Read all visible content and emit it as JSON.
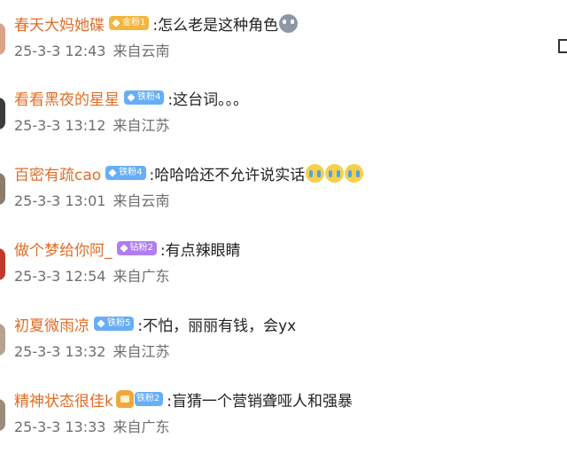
{
  "comments": [
    {
      "username": "春天大妈她碟",
      "badge": "金粉1",
      "badge_color": "#f4b63f",
      "text": ":怎么老是这种角色",
      "emoji": [
        "gray"
      ],
      "date": "25-3-3 12:43",
      "location": "来自云南"
    },
    {
      "username": "看看黑夜的星星",
      "badge": "铁粉4",
      "badge_color": "#66aef6",
      "text": ":这台词。。。",
      "emoji": [],
      "date": "25-3-3 13:12",
      "location": "来自江苏"
    },
    {
      "username": "百密有疏cao",
      "badge": "铁粉4",
      "badge_color": "#66aef6",
      "text": ":哈哈哈还不允许说实话",
      "emoji": [
        "cry",
        "cry",
        "cry"
      ],
      "date": "25-3-3 13:01",
      "location": "来自云南"
    },
    {
      "username": "做个梦给你阿_",
      "badge": "钻粉2",
      "badge_color": "#b07ef1",
      "text": ":有点辣眼睛",
      "emoji": [],
      "date": "25-3-3 12:54",
      "location": "来自广东"
    },
    {
      "username": "初夏微雨凉",
      "badge": "铁粉5",
      "badge_color": "#66aef6",
      "text": ":不怕，丽丽有钱，会yx",
      "emoji": [],
      "date": "25-3-3 13:32",
      "location": "来自江苏"
    },
    {
      "username": "精神状态很佳k",
      "badge": "铁粉2",
      "badge_color": "#66aef6",
      "text": ":盲猜一个营销聋哑人和强暴",
      "emoji": [],
      "date": "25-3-3 13:33",
      "location": "来自广东"
    }
  ]
}
